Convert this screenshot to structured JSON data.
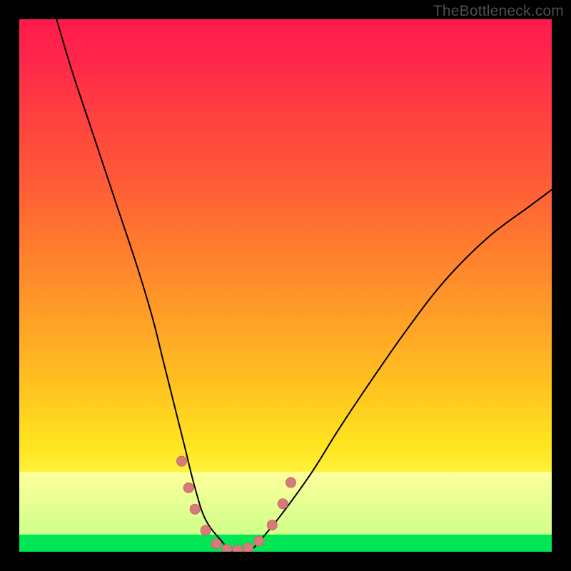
{
  "watermark": "TheBottleneck.com",
  "chart_data": {
    "type": "line",
    "title": "",
    "xlabel": "",
    "ylabel": "",
    "xlim": [
      0,
      100
    ],
    "ylim": [
      0,
      100
    ],
    "grid": false,
    "legend": false,
    "background_gradient": {
      "orientation": "vertical",
      "stops": [
        {
          "pos": 0.0,
          "color": "#ff1a4c"
        },
        {
          "pos": 0.18,
          "color": "#ff4040"
        },
        {
          "pos": 0.42,
          "color": "#ff7a2e"
        },
        {
          "pos": 0.68,
          "color": "#ffc020"
        },
        {
          "pos": 0.85,
          "color": "#feff9a"
        },
        {
          "pos": 0.968,
          "color": "#cfff8a"
        },
        {
          "pos": 1.0,
          "color": "#00e756"
        }
      ]
    },
    "series": [
      {
        "name": "curve",
        "stroke": "#000000",
        "stroke_width": 2,
        "x": [
          7,
          10,
          14,
          18,
          22,
          25,
          27,
          29,
          31,
          33,
          35,
          38,
          40,
          43,
          46,
          50,
          55,
          60,
          66,
          73,
          80,
          88,
          96,
          100
        ],
        "y": [
          100,
          90,
          78,
          66,
          54,
          44,
          36,
          28,
          20,
          12,
          6,
          2,
          0,
          0,
          3,
          8,
          15,
          23,
          32,
          42,
          51,
          59,
          65,
          68
        ]
      }
    ],
    "markers": {
      "name": "bottom-dots",
      "color": "#d97a7a",
      "radius_outer": 7,
      "stroke": "#c56a6a",
      "points": [
        {
          "x": 30.5,
          "y": 17
        },
        {
          "x": 31.8,
          "y": 12
        },
        {
          "x": 33.0,
          "y": 8
        },
        {
          "x": 35.0,
          "y": 4
        },
        {
          "x": 37.0,
          "y": 1.5
        },
        {
          "x": 39.0,
          "y": 0.5
        },
        {
          "x": 41.0,
          "y": 0.3
        },
        {
          "x": 43.0,
          "y": 0.7
        },
        {
          "x": 45.0,
          "y": 2.0
        },
        {
          "x": 47.5,
          "y": 5.0
        },
        {
          "x": 49.5,
          "y": 9.0
        },
        {
          "x": 51.0,
          "y": 13.0
        }
      ]
    }
  }
}
